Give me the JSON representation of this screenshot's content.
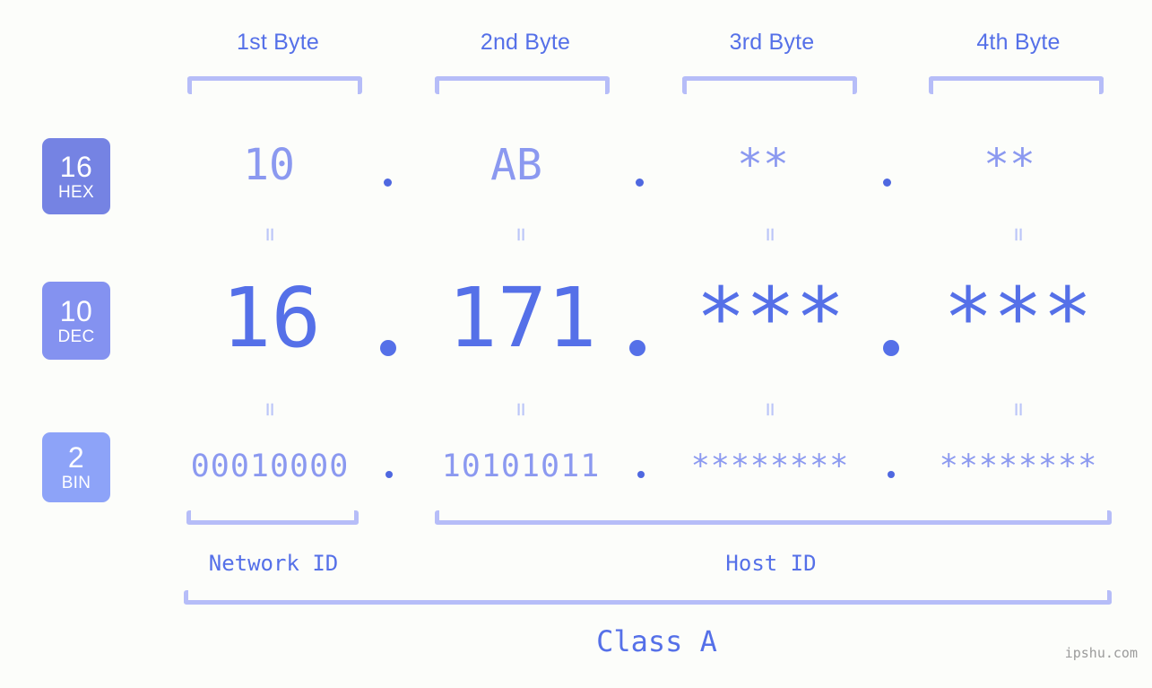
{
  "bytes": [
    {
      "header": "1st Byte",
      "hex": "10",
      "dec": "16",
      "bin": "00010000"
    },
    {
      "header": "2nd Byte",
      "hex": "AB",
      "dec": "171",
      "bin": "10101011"
    },
    {
      "header": "3rd Byte",
      "hex": "**",
      "dec": "***",
      "bin": "********"
    },
    {
      "header": "4th Byte",
      "hex": "**",
      "dec": "***",
      "bin": "********"
    }
  ],
  "bases": [
    {
      "number": "16",
      "label": "HEX",
      "color": "#7583e3"
    },
    {
      "number": "10",
      "label": "DEC",
      "color": "#8492f0"
    },
    {
      "number": "2",
      "label": "BIN",
      "color": "#8da3f8"
    }
  ],
  "separators": {
    "hex": ".",
    "dec": ".",
    "bin": "."
  },
  "equals_glyph": "=",
  "segments": {
    "network_id": "Network ID",
    "host_id": "Host ID",
    "class": "Class A"
  },
  "watermark": "ipshu.com",
  "colors": {
    "background": "#fcfdfa",
    "accent_strong": "#5570e8",
    "accent_light": "#8b99f0",
    "bracket": "#b6bdf8",
    "dot": "#4f68e0"
  }
}
